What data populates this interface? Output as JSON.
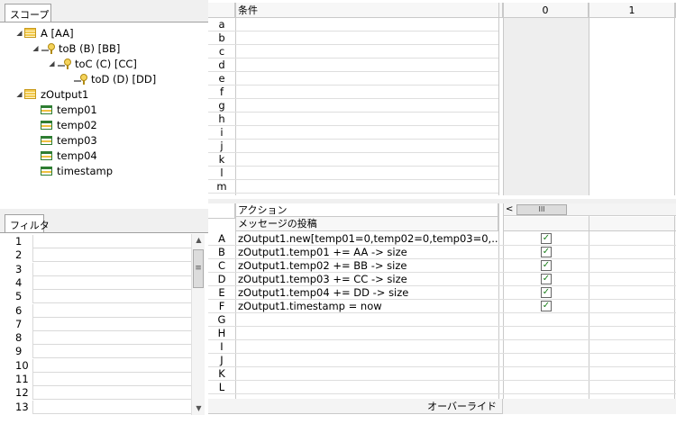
{
  "scope": {
    "tab_label": "スコープ",
    "tree": [
      {
        "label": "A [AA]",
        "icon": "table-icon",
        "expander": "◢",
        "indent": 0
      },
      {
        "label": "toB (B) [BB]",
        "icon": "key-icon",
        "expander": "◢",
        "indent": 1
      },
      {
        "label": "toC (C) [CC]",
        "icon": "key-icon",
        "expander": "◢",
        "indent": 2
      },
      {
        "label": "toD (D) [DD]",
        "icon": "key-icon",
        "expander": "",
        "indent": 3
      },
      {
        "label": "zOutput1",
        "icon": "table-icon",
        "expander": "◢",
        "indent": 0
      },
      {
        "label": "temp01",
        "icon": "field-icon",
        "expander": "",
        "indent": 1
      },
      {
        "label": "temp02",
        "icon": "field-icon",
        "expander": "",
        "indent": 1
      },
      {
        "label": "temp03",
        "icon": "field-icon",
        "expander": "",
        "indent": 1
      },
      {
        "label": "temp04",
        "icon": "field-icon",
        "expander": "",
        "indent": 1
      },
      {
        "label": "timestamp",
        "icon": "field-icon",
        "expander": "",
        "indent": 1
      }
    ]
  },
  "filter": {
    "tab_label": "フィルタ",
    "rows": [
      "1",
      "2",
      "3",
      "4",
      "5",
      "6",
      "7",
      "8",
      "9",
      "10",
      "11",
      "12",
      "13"
    ]
  },
  "conditions": {
    "header": "条件",
    "rule_columns": [
      "0",
      "1"
    ],
    "rows": [
      "a",
      "b",
      "c",
      "d",
      "e",
      "f",
      "g",
      "h",
      "i",
      "j",
      "k",
      "l",
      "m"
    ]
  },
  "actions": {
    "header": "アクション",
    "subheader": "メッセージの投稿",
    "override_label": "オーバーライド",
    "rows": [
      {
        "key": "A",
        "text": "zOutput1.new[temp01=0,temp02=0,temp03=0,...",
        "checked": true
      },
      {
        "key": "B",
        "text": "zOutput1.temp01 += AA -> size",
        "checked": true
      },
      {
        "key": "C",
        "text": "zOutput1.temp02 += BB -> size",
        "checked": true
      },
      {
        "key": "D",
        "text": "zOutput1.temp03 += CC -> size",
        "checked": true
      },
      {
        "key": "E",
        "text": "zOutput1.temp04 += DD -> size",
        "checked": true
      },
      {
        "key": "F",
        "text": "zOutput1.timestamp = now",
        "checked": true
      },
      {
        "key": "G",
        "text": "",
        "checked": false
      },
      {
        "key": "H",
        "text": "",
        "checked": false
      },
      {
        "key": "I",
        "text": "",
        "checked": false
      },
      {
        "key": "J",
        "text": "",
        "checked": false
      },
      {
        "key": "K",
        "text": "",
        "checked": false
      },
      {
        "key": "L",
        "text": "",
        "checked": false
      }
    ]
  },
  "glyphs": {
    "scroll_up": "▲",
    "scroll_down": "▼",
    "scroll_left": "<",
    "grip_v": "≡",
    "grip_h": "III",
    "check": "✓"
  },
  "colors": {
    "check": "#1a7f1a",
    "rule_column_bg": "#eeeeee"
  }
}
